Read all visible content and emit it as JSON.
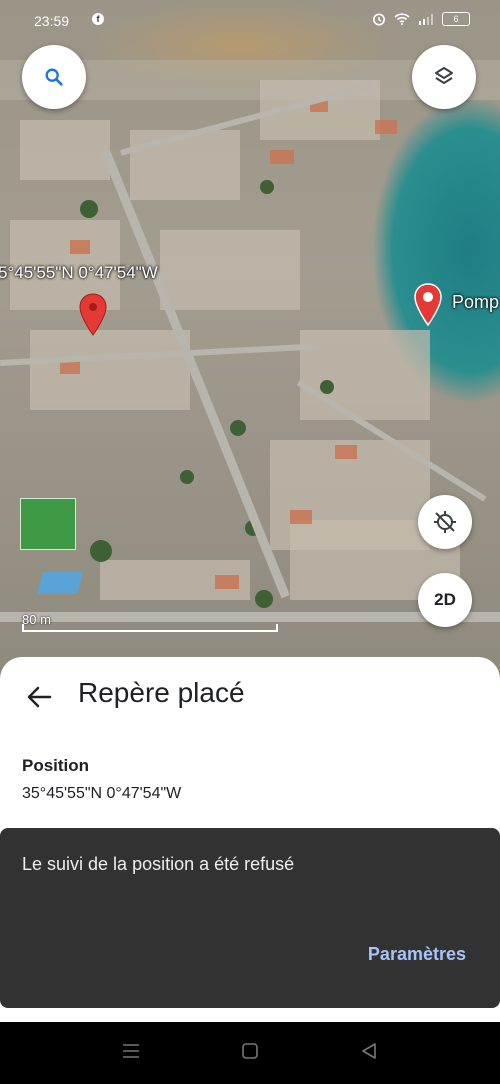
{
  "status_bar": {
    "time": "23:59",
    "app_icon": "facebook-icon",
    "battery": "6"
  },
  "map": {
    "coordinate_label": "5°45'55\"N 0°47'54\"W",
    "place_label": "Pomp",
    "scale_label": "80 m",
    "mode_button_label": "2D",
    "pin_color": "#e53935"
  },
  "sheet": {
    "title": "Repère placé",
    "position_label": "Position",
    "position_value": "35°45'55\"N 0°47'54\"W"
  },
  "snackbar": {
    "message": "Le suivi de la position a été refusé",
    "action": "Paramètres"
  }
}
